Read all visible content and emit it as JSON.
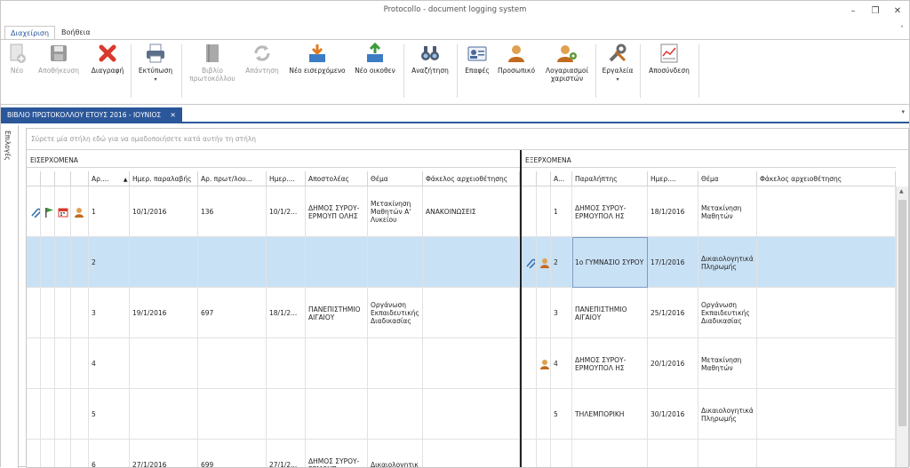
{
  "window": {
    "title": "Protocollo - document logging system",
    "minimize": "–",
    "restore": "❐",
    "close": "✕"
  },
  "menu_tabs": [
    {
      "label": "Διαχείριση"
    },
    {
      "label": "Βοήθεια"
    }
  ],
  "ribbon_collapse": "˄",
  "ribbon": [
    {
      "label": "Νέο",
      "disabled": true
    },
    {
      "label": "Αποθήκευση",
      "disabled": true
    },
    {
      "label": "Διαγραφή",
      "disabled": false
    },
    {
      "label": "Εκτύπωση",
      "disabled": false,
      "dropdown": "▾"
    },
    {
      "label": "Βιβλίο πρωτοκόλλου",
      "disabled": true
    },
    {
      "label": "Απάντηση",
      "disabled": true
    },
    {
      "label": "Νέο εισερχόμενο",
      "disabled": false
    },
    {
      "label": "Νέο οικοθεν",
      "disabled": false
    },
    {
      "label": "Αναζήτηση",
      "disabled": false
    },
    {
      "label": "Επαφές",
      "disabled": false
    },
    {
      "label": "Προσωπικό",
      "disabled": false
    },
    {
      "label": "Λογαριασμοί χαριστών",
      "disabled": false
    },
    {
      "label": "Εργαλεία",
      "disabled": false,
      "dropdown": "▾"
    },
    {
      "label": "Αποσύνδεση",
      "disabled": false
    }
  ],
  "doc_tab": {
    "label": "ΒΙΒΛΙΟ ΠΡΩΤΟΚΟΛΛΟΥ ΕΤΟΥΣ 2016 - ΙΟΥΝΙΟΣ",
    "close": "✕",
    "dropdown": "▾"
  },
  "left_panel": {
    "label": "Επιλογές"
  },
  "group_placeholder": "Σύρετε μία στήλη εδώ για να ομαδοποιήσετε κατά αυτήν τη στήλη",
  "incoming": {
    "band": "ΕΙΣΕΡΧΟΜΕΝΑ",
    "columns": [
      "Αρ....",
      "Ημερ. παραλαβής",
      "Αρ. πρωτ/λου...",
      "Ημερ....",
      "Αποστολέας",
      "Θέμα",
      "Φάκελος αρχειοθέτησης"
    ],
    "sort_icon": "▲"
  },
  "outgoing": {
    "band": "ΕΞΕΡΧΟΜΕΝΑ",
    "columns": [
      "Α...",
      "Παραλήπτης",
      "Ημερ....",
      "Θέμα",
      "Φάκελος αρχειοθέτησης"
    ]
  },
  "rows": [
    {
      "in_no": "1",
      "in_recv": "10/1/2016",
      "in_prot": "136",
      "in_date": "10/1/2...",
      "in_sender": "ΔΗΜΟΣ ΣΥΡΟΥ-ΕΡΜΟΥΠ ΟΛΗΣ",
      "in_subject": "Μετακίνηση Μαθητών Α' Λυκείου",
      "in_folder": "ΑΝΑΚΟΙΝΩΣΕΙΣ",
      "out_no": "1",
      "out_to": "ΔΗΜΟΣ ΣΥΡΟΥ-ΕΡΜΟΥΠΟΛ ΗΣ",
      "out_date": "18/1/2016",
      "out_subject": "Μετακίνηση Μαθητών",
      "out_folder": ""
    },
    {
      "in_no": "2",
      "in_recv": "",
      "in_prot": "",
      "in_date": "",
      "in_sender": "",
      "in_subject": "",
      "in_folder": "",
      "out_no": "2",
      "out_to": "1ο ΓΥΜΝΑΣΙΟ ΣΥΡΟΥ",
      "out_date": "17/1/2016",
      "out_subject": "Δικαιολογητικά Πληρωμής",
      "out_folder": ""
    },
    {
      "in_no": "3",
      "in_recv": "19/1/2016",
      "in_prot": "697",
      "in_date": "18/1/2...",
      "in_sender": "ΠΑΝΕΠΙΣΤΗΜΙΟ ΑΙΓΑΙΟΥ",
      "in_subject": "Οργάνωση Εκπαιδευτικής Διαδικασίας",
      "in_folder": "",
      "out_no": "3",
      "out_to": "ΠΑΝΕΠΙΣΤΗΜΙΟ ΑΙΓΑΙΟΥ",
      "out_date": "25/1/2016",
      "out_subject": "Οργάνωση Εκπαιδευτικής Διαδικασίας",
      "out_folder": ""
    },
    {
      "in_no": "4",
      "in_recv": "",
      "in_prot": "",
      "in_date": "",
      "in_sender": "",
      "in_subject": "",
      "in_folder": "",
      "out_no": "4",
      "out_to": "ΔΗΜΟΣ ΣΥΡΟΥ-ΕΡΜΟΥΠΟΛ ΗΣ",
      "out_date": "20/1/2016",
      "out_subject": "Μετακίνηση Μαθητών",
      "out_folder": ""
    },
    {
      "in_no": "5",
      "in_recv": "",
      "in_prot": "",
      "in_date": "",
      "in_sender": "",
      "in_subject": "",
      "in_folder": "",
      "out_no": "5",
      "out_to": "ΤΗΛΕΜΠΟΡΙΚΗ",
      "out_date": "30/1/2016",
      "out_subject": "Δικαιολογητικά Πληρωμής",
      "out_folder": ""
    },
    {
      "in_no": "6",
      "in_recv": "27/1/2016",
      "in_prot": "699",
      "in_date": "27/1/2...",
      "in_sender": "ΔΗΜΟΣ ΣΥΡΟΥ-ΕΡΜΟΥΠ",
      "in_subject": "Δικαιολογητικ",
      "in_folder": "",
      "out_no": "",
      "out_to": "",
      "out_date": "",
      "out_subject": "",
      "out_folder": ""
    }
  ],
  "colors": {
    "accent": "#2b579a",
    "selected_row": "#c9e1f5"
  }
}
